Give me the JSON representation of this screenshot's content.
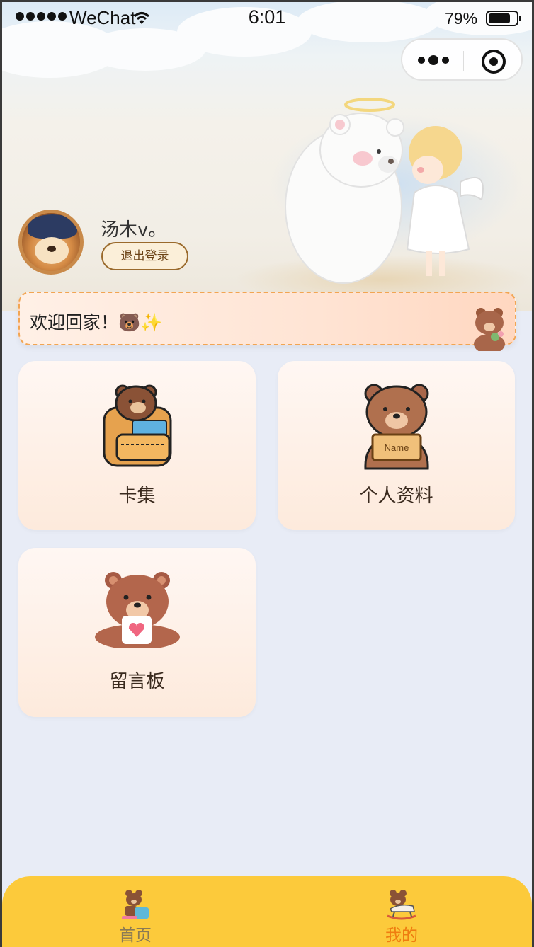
{
  "status_bar": {
    "carrier": "WeChat",
    "time": "6:01",
    "battery": "79%",
    "battery_level": 0.79
  },
  "capsule": {
    "more_icon": "more-dots-icon",
    "close_icon": "target-close-icon"
  },
  "profile": {
    "username": "汤木v。",
    "logout_label": "退出登录",
    "avatar_icon": "dog-avatar"
  },
  "welcome": {
    "text": "欢迎回家！🐻✨"
  },
  "menu": {
    "items": [
      {
        "label": "卡集",
        "icon": "bear-backpack-icon"
      },
      {
        "label": "个人资料",
        "icon": "bear-name-tag-icon"
      },
      {
        "label": "留言板",
        "icon": "bear-heart-letter-icon"
      }
    ]
  },
  "tabbar": {
    "items": [
      {
        "label": "首页",
        "icon": "bear-home-icon",
        "active": false,
        "color": "#8a7a55"
      },
      {
        "label": "我的",
        "icon": "bear-rocking-horse-icon",
        "active": true,
        "color": "#ef7d10"
      }
    ],
    "background": "#fcca3b"
  },
  "colors": {
    "page_background": "#e8ecf6",
    "accent_border": "#f2a552"
  }
}
